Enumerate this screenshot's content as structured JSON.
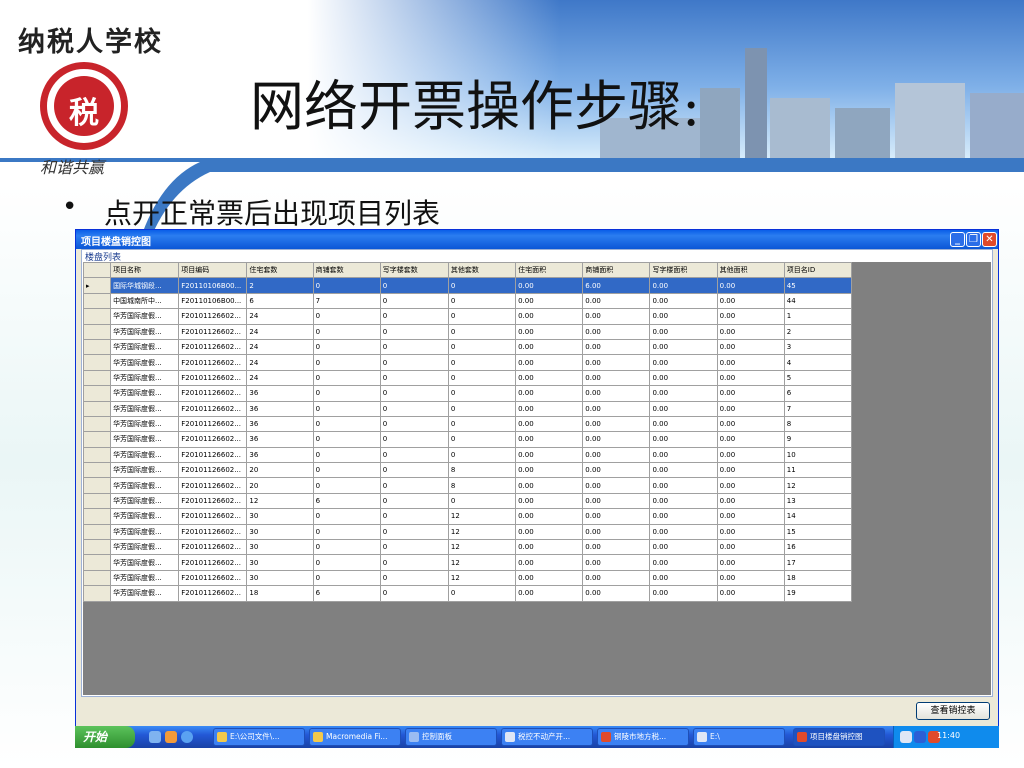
{
  "slide": {
    "logo_text": "纳税人学校",
    "seal_mark": "税",
    "motto": "和谐共赢",
    "title": "网络开票操作步骤:",
    "bullet": "点开正常票后出现项目列表"
  },
  "window": {
    "title": "项目楼盘销控图",
    "grid_label": "楼盘列表",
    "view_button": "查看销控表",
    "columns": [
      "项目名称",
      "项目编码",
      "住宅套数",
      "商铺套数",
      "写字楼套数",
      "其他套数",
      "住宅面积",
      "商铺面积",
      "写字楼面积",
      "其他面积",
      "项目名ID"
    ],
    "rows": [
      [
        "国际华城钢段...",
        "F20110106B00...",
        "2",
        "0",
        "0",
        "0",
        "0.00",
        "6.00",
        "0.00",
        "0.00",
        "45"
      ],
      [
        "中国城南所中...",
        "F20110106B00...",
        "6",
        "7",
        "0",
        "0",
        "0.00",
        "0.00",
        "0.00",
        "0.00",
        "44"
      ],
      [
        "华芳国际度假...",
        "F20101126602...",
        "24",
        "0",
        "0",
        "0",
        "0.00",
        "0.00",
        "0.00",
        "0.00",
        "1"
      ],
      [
        "华芳国际度假...",
        "F20101126602...",
        "24",
        "0",
        "0",
        "0",
        "0.00",
        "0.00",
        "0.00",
        "0.00",
        "2"
      ],
      [
        "华芳国际度假...",
        "F20101126602...",
        "24",
        "0",
        "0",
        "0",
        "0.00",
        "0.00",
        "0.00",
        "0.00",
        "3"
      ],
      [
        "华芳国际度假...",
        "F20101126602...",
        "24",
        "0",
        "0",
        "0",
        "0.00",
        "0.00",
        "0.00",
        "0.00",
        "4"
      ],
      [
        "华芳国际度假...",
        "F20101126602...",
        "24",
        "0",
        "0",
        "0",
        "0.00",
        "0.00",
        "0.00",
        "0.00",
        "5"
      ],
      [
        "华芳国际度假...",
        "F20101126602...",
        "36",
        "0",
        "0",
        "0",
        "0.00",
        "0.00",
        "0.00",
        "0.00",
        "6"
      ],
      [
        "华芳国际度假...",
        "F20101126602...",
        "36",
        "0",
        "0",
        "0",
        "0.00",
        "0.00",
        "0.00",
        "0.00",
        "7"
      ],
      [
        "华芳国际度假...",
        "F20101126602...",
        "36",
        "0",
        "0",
        "0",
        "0.00",
        "0.00",
        "0.00",
        "0.00",
        "8"
      ],
      [
        "华芳国际度假...",
        "F20101126602...",
        "36",
        "0",
        "0",
        "0",
        "0.00",
        "0.00",
        "0.00",
        "0.00",
        "9"
      ],
      [
        "华芳国际度假...",
        "F20101126602...",
        "36",
        "0",
        "0",
        "0",
        "0.00",
        "0.00",
        "0.00",
        "0.00",
        "10"
      ],
      [
        "华芳国际度假...",
        "F20101126602...",
        "20",
        "0",
        "0",
        "8",
        "0.00",
        "0.00",
        "0.00",
        "0.00",
        "11"
      ],
      [
        "华芳国际度假...",
        "F20101126602...",
        "20",
        "0",
        "0",
        "8",
        "0.00",
        "0.00",
        "0.00",
        "0.00",
        "12"
      ],
      [
        "华芳国际度假...",
        "F20101126602...",
        "12",
        "6",
        "0",
        "0",
        "0.00",
        "0.00",
        "0.00",
        "0.00",
        "13"
      ],
      [
        "华芳国际度假...",
        "F20101126602...",
        "30",
        "0",
        "0",
        "12",
        "0.00",
        "0.00",
        "0.00",
        "0.00",
        "14"
      ],
      [
        "华芳国际度假...",
        "F20101126602...",
        "30",
        "0",
        "0",
        "12",
        "0.00",
        "0.00",
        "0.00",
        "0.00",
        "15"
      ],
      [
        "华芳国际度假...",
        "F20101126602...",
        "30",
        "0",
        "0",
        "12",
        "0.00",
        "0.00",
        "0.00",
        "0.00",
        "16"
      ],
      [
        "华芳国际度假...",
        "F20101126602...",
        "30",
        "0",
        "0",
        "12",
        "0.00",
        "0.00",
        "0.00",
        "0.00",
        "17"
      ],
      [
        "华芳国际度假...",
        "F20101126602...",
        "30",
        "0",
        "0",
        "12",
        "0.00",
        "0.00",
        "0.00",
        "0.00",
        "18"
      ],
      [
        "华芳国际度假...",
        "F20101126602...",
        "18",
        "6",
        "0",
        "0",
        "0.00",
        "0.00",
        "0.00",
        "0.00",
        "19"
      ]
    ],
    "selected_row": 0
  },
  "taskbar": {
    "start": "开始",
    "tasks": [
      {
        "label": "E:\\公司文件\\...",
        "icon": "folder-icon",
        "color": "#f2c94c"
      },
      {
        "label": "Macromedia Fi...",
        "icon": "flash-icon",
        "color": "#f2c94c"
      },
      {
        "label": "控制面板",
        "icon": "control-panel-icon",
        "color": "#9bbcf2"
      },
      {
        "label": "税控不动产开...",
        "icon": "document-icon",
        "color": "#dfe6f5"
      },
      {
        "label": "铜陵市地方税...",
        "icon": "app-icon",
        "color": "#e04a2a"
      },
      {
        "label": "E:\\",
        "icon": "drive-icon",
        "color": "#dfe6f5"
      },
      {
        "label": "项目楼盘销控图",
        "icon": "app-icon",
        "color": "#e04a2a"
      }
    ],
    "clock": "11:40"
  }
}
